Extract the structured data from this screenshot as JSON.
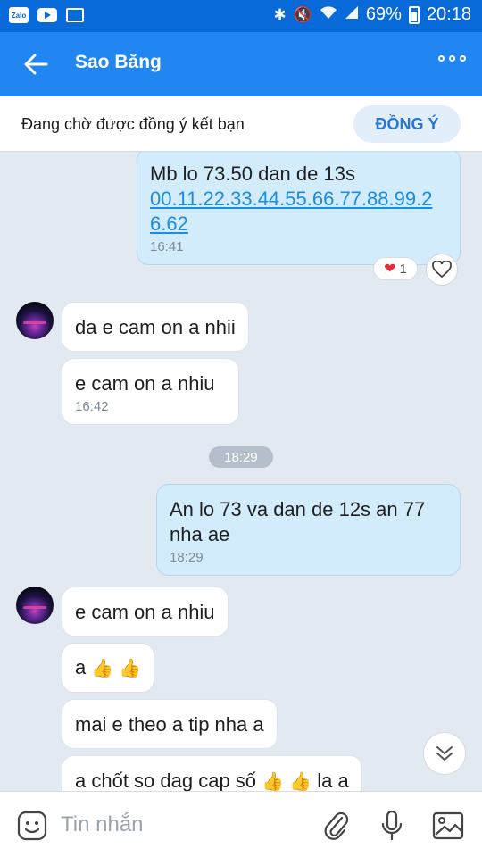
{
  "status_bar": {
    "app_icon_text": "Zalo",
    "battery": "69%",
    "time": "20:18"
  },
  "header": {
    "title": "Sao Băng"
  },
  "pending": {
    "text": "Đang chờ được đồng ý kết bạn",
    "accept_label": "ĐỒNG Ý"
  },
  "messages": {
    "m1": {
      "line": "Mb lo 73.50 dan de 13s",
      "link": "00.11.22.33.44.55.66.77.88.99.26.62",
      "time": "16:41"
    },
    "reaction_count": "1",
    "m2": {
      "text": "da e cam on a nhii"
    },
    "m3": {
      "text": "e cam on a nhiu",
      "time": "16:42"
    },
    "divider_time": "18:29",
    "m4": {
      "text": "An lo 73 va dan de 12s an 77 nha ae",
      "time": "18:29"
    },
    "m5": {
      "text": "e cam on a nhiu"
    },
    "m6": {
      "prefix": "a"
    },
    "m7": {
      "text": "mai e theo a tip nha a"
    },
    "m8": {
      "prefix": "a chốt so dag cap số",
      "suffix": "la a"
    }
  },
  "input": {
    "placeholder": "Tin nhắn"
  },
  "icons": {
    "back": "arrow-left-icon",
    "more": "more-horizontal-icon",
    "heart": "heart-icon",
    "like": "heart-outline-icon",
    "thumbs": "thumbs-up-emoji",
    "scroll": "chevron-double-down-icon",
    "emoji": "sticker-icon",
    "attach": "paperclip-icon",
    "mic": "microphone-icon",
    "image": "image-icon"
  },
  "colors": {
    "header": "#2286f2",
    "status_bar": "#0869d8",
    "outgoing_bubble": "#d3ecfc",
    "chat_bg": "#e2e9f1",
    "accent": "#2477d4"
  }
}
